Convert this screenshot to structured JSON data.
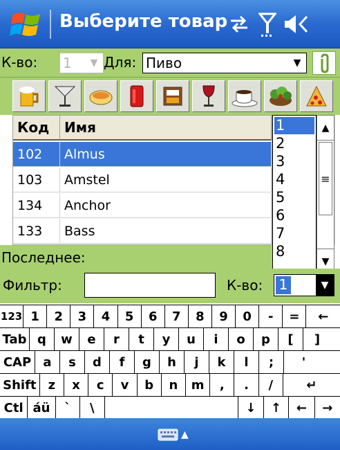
{
  "titlebar": {
    "title": "Выберите товар",
    "icons": [
      "connectivity-icon",
      "signal-icon",
      "volume-icon"
    ]
  },
  "form": {
    "qty_label": "К-во:",
    "qty_value": "1",
    "for_label": "Для:",
    "for_value": "Пиво",
    "attach_icon": "paperclip-icon"
  },
  "categories": [
    "beer-icon",
    "cocktail-icon",
    "soup-icon",
    "soda-can-icon",
    "dessert-icon",
    "wine-icon",
    "coffee-icon",
    "salad-icon",
    "pizza-icon"
  ],
  "grid": {
    "columns": [
      "Код",
      "Имя"
    ],
    "rows": [
      {
        "code": "102",
        "name": "Almus",
        "selected": true
      },
      {
        "code": "103",
        "name": "Amstel",
        "selected": false
      },
      {
        "code": "134",
        "name": "Anchor",
        "selected": false
      },
      {
        "code": "133",
        "name": "Bass",
        "selected": false
      }
    ]
  },
  "qty_list": [
    "1",
    "2",
    "3",
    "4",
    "5",
    "6",
    "7",
    "8"
  ],
  "last_label": "Последнее:",
  "filter": {
    "label": "Фильтр:",
    "value": "",
    "qty_label": "К-во:",
    "qty_value": "1"
  },
  "keyboard": {
    "rows": [
      [
        "123",
        "1",
        "2",
        "3",
        "4",
        "5",
        "6",
        "7",
        "8",
        "9",
        "0",
        "-",
        "=",
        "←"
      ],
      [
        "Tab",
        "q",
        "w",
        "e",
        "r",
        "t",
        "y",
        "u",
        "i",
        "o",
        "p",
        "[",
        "]"
      ],
      [
        "CAP",
        "a",
        "s",
        "d",
        "f",
        "g",
        "h",
        "j",
        "k",
        "l",
        ";",
        "'"
      ],
      [
        "Shift",
        "z",
        "x",
        "c",
        "v",
        "b",
        "n",
        "m",
        ",",
        ".",
        "/",
        "↵"
      ],
      [
        "Ctl",
        "áü",
        "`",
        "\\",
        " ",
        "↓",
        "↑",
        "←",
        "→"
      ]
    ]
  },
  "colors": {
    "titlebar": "#2a6ad0",
    "panel_green": "#a8d070",
    "selection": "#3a76d8"
  }
}
